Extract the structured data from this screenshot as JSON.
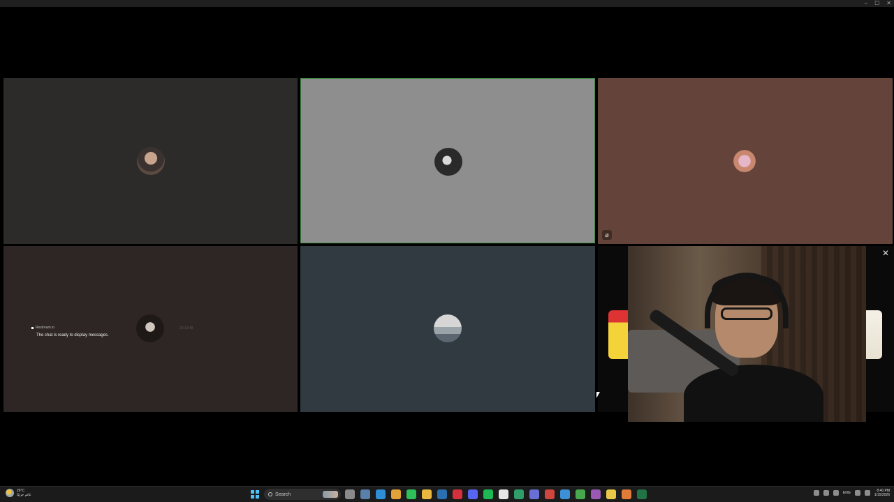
{
  "window": {
    "controls": [
      "–",
      "☐",
      "✕"
    ]
  },
  "tiles": [
    {
      "name": "participant-1",
      "color": "#2d2b29"
    },
    {
      "name": "participant-2",
      "color": "#8e8e8e",
      "speaking": true
    },
    {
      "name": "participant-3",
      "color": "#64443a",
      "muted": true
    },
    {
      "name": "participant-4",
      "color": "#2e2624"
    },
    {
      "name": "participant-5",
      "color": "#313941"
    },
    {
      "name": "participant-6",
      "color": "#0a0a0a"
    }
  ],
  "chat_overlay": {
    "source": "Restream.io",
    "message": "The chat is ready to display messages.",
    "timestamp": "20:13:48"
  },
  "mute_icon": "mic-off-icon",
  "taskbar": {
    "weather": {
      "temp": "26°C",
      "condition": "غائم جزئيًا"
    },
    "search_label": "Search",
    "apps": [
      {
        "name": "task-view-icon",
        "color": "#8a8a8a"
      },
      {
        "name": "widgets-icon",
        "color": "#5a7fa8"
      },
      {
        "name": "edge-icon",
        "color": "#2f8fd6"
      },
      {
        "name": "chrome-icon",
        "color": "#e2a23a"
      },
      {
        "name": "whatsapp-icon",
        "color": "#2fbf5a"
      },
      {
        "name": "file-explorer-icon",
        "color": "#e8b740"
      },
      {
        "name": "linkedin-icon",
        "color": "#2a6fb0"
      },
      {
        "name": "opera-icon",
        "color": "#d6303c"
      },
      {
        "name": "discord-icon",
        "color": "#5865f2"
      },
      {
        "name": "spotify-icon",
        "color": "#1db954"
      },
      {
        "name": "tiktok-icon",
        "color": "#e6e6e6"
      },
      {
        "name": "meet-icon",
        "color": "#2f9e6a"
      },
      {
        "name": "teams-icon",
        "color": "#6a6fd6"
      },
      {
        "name": "chrome-profile-icon",
        "color": "#d0463e"
      },
      {
        "name": "chrome-profile-2-icon",
        "color": "#3d8fd6"
      },
      {
        "name": "chrome-profile-3-icon",
        "color": "#48a84e"
      },
      {
        "name": "chrome-profile-4-icon",
        "color": "#9b59b6"
      },
      {
        "name": "sticky-notes-icon",
        "color": "#e8c64a"
      },
      {
        "name": "chrome-profile-5-icon",
        "color": "#e07b39"
      },
      {
        "name": "excel-icon",
        "color": "#217346"
      }
    ],
    "language": "ENG",
    "time": "8:40 PM",
    "date": "1/15/2026"
  }
}
